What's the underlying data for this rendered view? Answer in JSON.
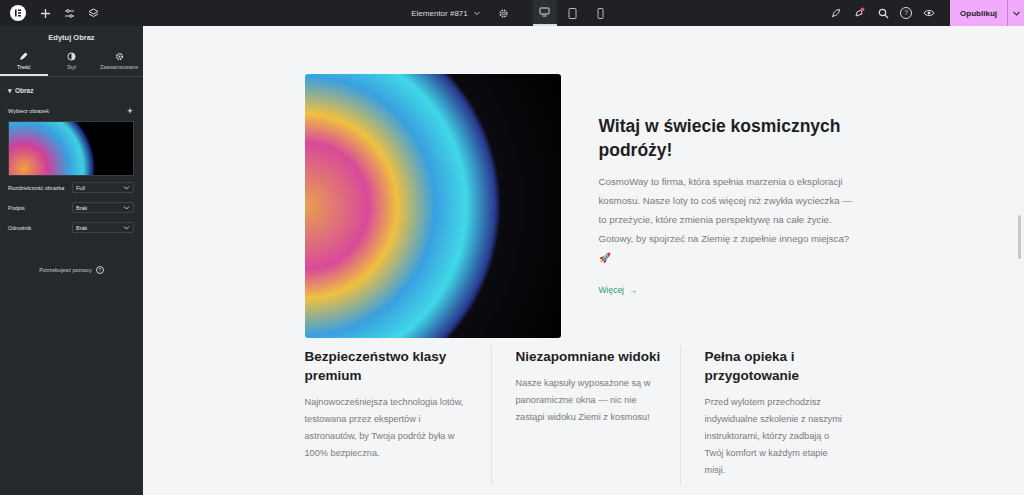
{
  "topbar": {
    "document": "Elementor #871",
    "devices": [
      {
        "kind": "desktop",
        "selected": true
      },
      {
        "kind": "tablet",
        "selected": false
      },
      {
        "kind": "mobile",
        "selected": false
      }
    ],
    "help_icon": "?",
    "publish": "Opublikuj"
  },
  "panel": {
    "title": "Edytuj Obraz",
    "tabs": [
      {
        "label": "Treść",
        "kind": "pencil",
        "selected": true
      },
      {
        "label": "Styl",
        "kind": "contrast",
        "selected": false
      },
      {
        "label": "Zaawansowane",
        "kind": "gear",
        "selected": false
      }
    ],
    "section": {
      "marker": "▾",
      "title": "Obraz",
      "expanded": true
    },
    "image_label": "Wybierz obrazek",
    "fields": [
      {
        "label": "Rozdzielczość obrazka",
        "value": "Full"
      },
      {
        "label": "Podpis",
        "value": "Brak"
      },
      {
        "label": "Odnośnik",
        "value": "Brak"
      }
    ],
    "help": "Potrzebujesz pomocy",
    "help_icon": "?",
    "collapse": "‹"
  },
  "page": {
    "heading": "Witaj w świecie kosmicznych podróży!",
    "text": "CosmoWay to firma, która spełnia marzenia o eksploracji kosmosu. Nasze loty to coś więcej niż zwykła wycieczka — to przeżycie, które zmienia perspektywę na całe życie. Gotowy, by spojrzeć na Ziemię z zupełnie innego miejsca? 🚀",
    "link": {
      "label": "Więcej",
      "arrow": "→"
    },
    "features": [
      {
        "title": "Bezpieczeństwo klasy premium",
        "text": "Najnowocześniejsza technologia lotów, testowana przez ekspertów i astronautów, by Twoja podróż była w 100% bezpieczna."
      },
      {
        "title": "Niezapomniane widoki",
        "text": "Nasze kapsuły wyposażone są w panoramiczne okna — nic nie zastąpi widoku Ziemi z kosmosu!"
      },
      {
        "title": "Pełna opieka i przygotowanie",
        "text": "Przed wylotem przechodzisz indywidualne szkolenie z naszymi instruktorami, którzy zadbają o Twój komfort w każdym etapie misji."
      }
    ]
  }
}
